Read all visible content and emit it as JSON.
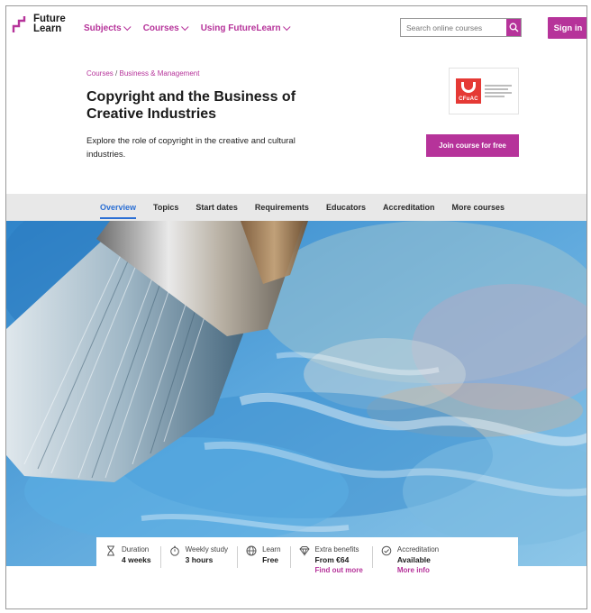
{
  "header": {
    "logo_line1": "Future",
    "logo_line2": "Learn",
    "nav": [
      {
        "label": "Subjects"
      },
      {
        "label": "Courses"
      },
      {
        "label": "Using FutureLearn"
      }
    ],
    "search_placeholder": "Search online courses",
    "signin_label": "Sign in"
  },
  "breadcrumb": {
    "root": "Courses",
    "separator": "/",
    "category": "Business & Management"
  },
  "course": {
    "title": "Copyright and the Business of Creative Industries",
    "description": "Explore the role of copyright in the creative and cultural industries.",
    "partner_logo_text": "CFuAC",
    "join_label": "Join course for free"
  },
  "tabs": [
    {
      "label": "Overview",
      "active": true
    },
    {
      "label": "Topics"
    },
    {
      "label": "Start dates"
    },
    {
      "label": "Requirements"
    },
    {
      "label": "Educators"
    },
    {
      "label": "Accreditation"
    },
    {
      "label": "More courses"
    }
  ],
  "info": [
    {
      "icon": "hourglass-icon",
      "label": "Duration",
      "value": "4 weeks"
    },
    {
      "icon": "stopwatch-icon",
      "label": "Weekly study",
      "value": "3 hours"
    },
    {
      "icon": "globe-icon",
      "label": "Learn",
      "value": "Free"
    },
    {
      "icon": "diamond-icon",
      "label": "Extra benefits",
      "value": "From €64",
      "link": "Find out more"
    },
    {
      "icon": "badge-check-icon",
      "label": "Accreditation",
      "value": "Available",
      "link": "More info"
    }
  ],
  "colors": {
    "brand": "#b6339a",
    "tab_active": "#2b6fd4",
    "tab_bar": "#e8e8e8"
  }
}
